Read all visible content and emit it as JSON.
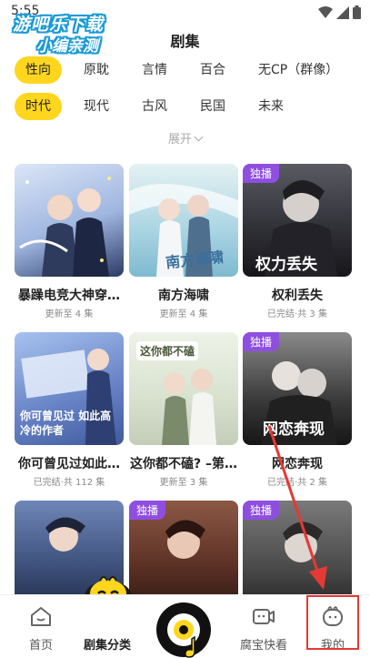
{
  "status_bar": {
    "time": "5:55"
  },
  "watermark": {
    "line1": "游吧乐下载",
    "line2": "小编亲测"
  },
  "header": {
    "title": "剧集"
  },
  "filters": {
    "row1": [
      "性向",
      "原耽",
      "言情",
      "百合",
      "无CP（群像）"
    ],
    "row2": [
      "时代",
      "现代",
      "古风",
      "民国",
      "未来"
    ],
    "active_row1": "性向",
    "active_row2": "时代"
  },
  "expand": {
    "label": "展开"
  },
  "cards": [
    {
      "title": "暴躁电竞大神穿…",
      "subtitle": "更新至 4 集",
      "badge": "",
      "cover_text": "",
      "cover_color": "#c8d6ee"
    },
    {
      "title": "南方海啸",
      "subtitle": "更新至 4 集",
      "badge": "",
      "cover_text": "南方海啸",
      "cover_color": "#b9dce8"
    },
    {
      "title": "权利丢失",
      "subtitle": "已完结·共 3 集",
      "badge": "独播",
      "cover_text": "权力丢失",
      "cover_color": "#2e2e35"
    },
    {
      "title": "你可曾见过如此…",
      "subtitle": "已完结·共 112 集",
      "badge": "",
      "cover_text": "你可曾见过 如此高冷的作者",
      "cover_color": "#6a86c8"
    },
    {
      "title": "这你都不磕? –第…",
      "subtitle": "更新至 3 集",
      "badge": "",
      "cover_text": "这你都不磕",
      "cover_color": "#d9e3d0"
    },
    {
      "title": "网恋奔现",
      "subtitle": "已完结·共 2 集",
      "badge": "独播",
      "cover_text": "网恋奔现",
      "cover_color": "#3a3a3a"
    },
    {
      "title": "",
      "subtitle": "",
      "badge": "",
      "cover_text": "",
      "cover_color": "#3c4f7a"
    },
    {
      "title": "",
      "subtitle": "",
      "badge": "独播",
      "cover_text": "",
      "cover_color": "#5a3024"
    },
    {
      "title": "",
      "subtitle": "",
      "badge": "独播",
      "cover_text": "",
      "cover_color": "#4a4a4a"
    }
  ],
  "bottom_nav": {
    "items": [
      "首页",
      "剧集分类",
      "",
      "腐宝快看",
      "我的"
    ],
    "active": "剧集分类"
  },
  "colors": {
    "accent": "#ffd61e",
    "badge": "#8e4fe0",
    "highlight": "#e53935"
  }
}
